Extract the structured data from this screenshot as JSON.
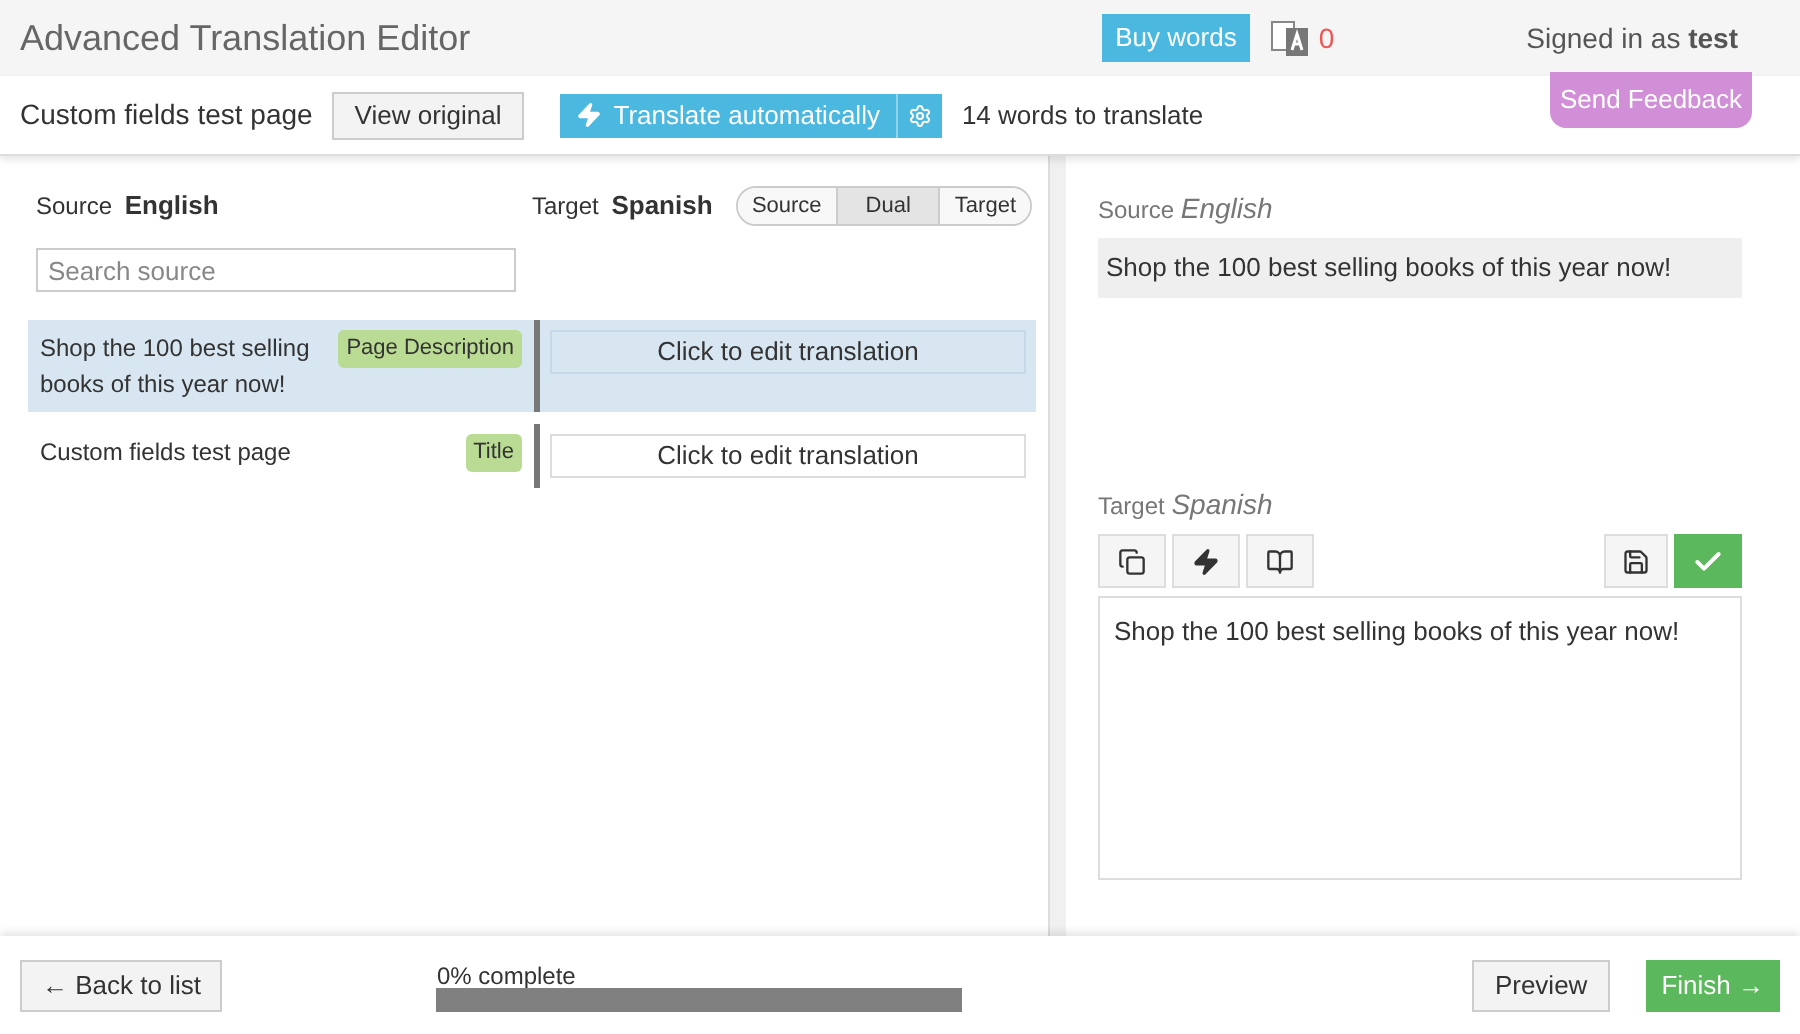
{
  "header": {
    "title": "Advanced Translation Editor",
    "buy_words": "Buy words",
    "credit_count": "0",
    "signed_in_label": "Signed in as",
    "user": "test"
  },
  "toolbar": {
    "page_name": "Custom fields test page",
    "view_original": "View original",
    "translate_automatically": "Translate automatically",
    "word_count": "14 words to translate",
    "feedback": "Send Feedback"
  },
  "list": {
    "source_label": "Source",
    "source_language": "English",
    "target_label": "Target",
    "target_language": "Spanish",
    "view_modes": [
      {
        "label": "Source",
        "selected": false
      },
      {
        "label": "Dual",
        "selected": true
      },
      {
        "label": "Target",
        "selected": false
      }
    ],
    "search": {
      "placeholder": "Search source"
    },
    "rows": [
      {
        "source": "Shop the 100 best selling books of this year now!",
        "tag": "Page Description",
        "translation_placeholder": "Click to edit translation",
        "selected": true
      },
      {
        "source": "Custom fields test page",
        "tag": "Title",
        "translation_placeholder": "Click to edit translation",
        "selected": false
      }
    ]
  },
  "editor": {
    "source_label": "Source",
    "source_language": "English",
    "source_text": "Shop the 100 best selling books of this year now!",
    "target_label": "Target",
    "target_language": "Spanish",
    "target_text": "Shop the 100 best selling books of this year now!"
  },
  "footer": {
    "back": "← Back to list",
    "progress_label": "0% complete",
    "progress": {
      "level": 0
    },
    "preview": "Preview",
    "finish": "Finish →"
  }
}
